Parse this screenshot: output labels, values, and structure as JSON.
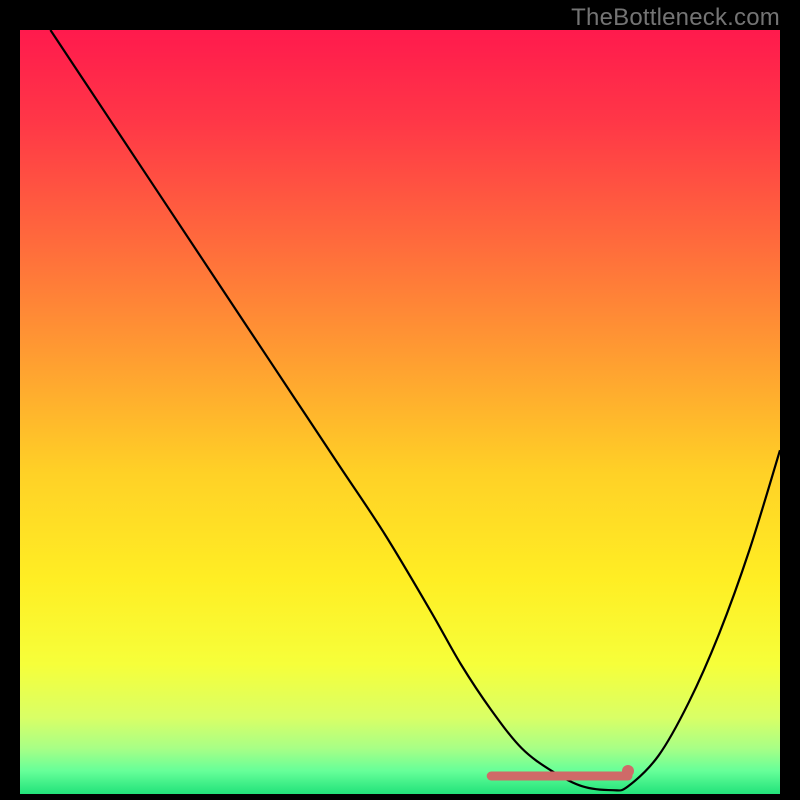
{
  "watermark": "TheBottleneck.com",
  "chart_data": {
    "type": "line",
    "title": "",
    "xlabel": "",
    "ylabel": "",
    "xlim": [
      0,
      100
    ],
    "ylim": [
      0,
      100
    ],
    "background_gradient_stops": [
      {
        "offset": 0.0,
        "color": "#ff1a4d"
      },
      {
        "offset": 0.12,
        "color": "#ff3747"
      },
      {
        "offset": 0.28,
        "color": "#ff6b3c"
      },
      {
        "offset": 0.42,
        "color": "#ff9a32"
      },
      {
        "offset": 0.58,
        "color": "#ffd126"
      },
      {
        "offset": 0.72,
        "color": "#ffee24"
      },
      {
        "offset": 0.83,
        "color": "#f6ff3a"
      },
      {
        "offset": 0.9,
        "color": "#d9ff66"
      },
      {
        "offset": 0.94,
        "color": "#a8ff86"
      },
      {
        "offset": 0.97,
        "color": "#66ff99"
      },
      {
        "offset": 1.0,
        "color": "#22e27a"
      }
    ],
    "series": [
      {
        "name": "bottleneck-curve",
        "color": "#000000",
        "x": [
          4,
          8,
          12,
          18,
          24,
          30,
          36,
          42,
          48,
          54,
          58,
          62,
          66,
          70,
          74,
          78,
          80,
          84,
          88,
          92,
          96,
          100
        ],
        "y": [
          100,
          94,
          88,
          79,
          70,
          61,
          52,
          43,
          34,
          24,
          17,
          11,
          6,
          3,
          1,
          0.5,
          1,
          5,
          12,
          21,
          32,
          45
        ]
      }
    ],
    "highlight_band": {
      "name": "optimal-range",
      "x": [
        62,
        80
      ],
      "y_offset": 0,
      "color": "#cf6a68",
      "thickness": 9
    },
    "highlight_dot": {
      "name": "optimal-point",
      "x": 80,
      "y": 1,
      "radius": 6,
      "color": "#cf6a68"
    }
  }
}
